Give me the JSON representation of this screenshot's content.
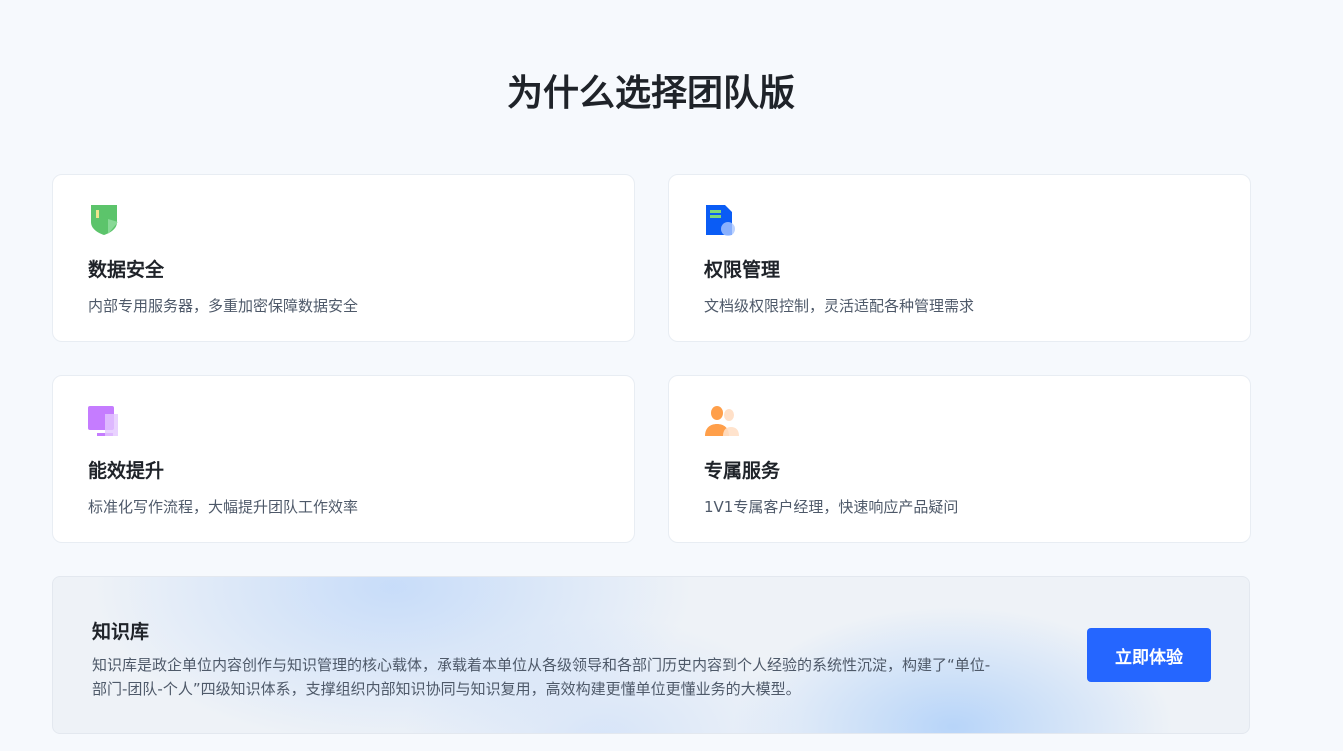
{
  "title": "为什么选择团队版",
  "features": [
    {
      "icon": "shield-icon",
      "title": "数据安全",
      "desc": "内部专用服务器，多重加密保障数据安全"
    },
    {
      "icon": "document-icon",
      "title": "权限管理",
      "desc": "文档级权限控制，灵活适配各种管理需求"
    },
    {
      "icon": "monitor-icon",
      "title": "能效提升",
      "desc": "标准化写作流程，大幅提升团队工作效率"
    },
    {
      "icon": "support-person-icon",
      "title": "专属服务",
      "desc": "1V1专属客户经理，快速响应产品疑问"
    }
  ],
  "knowledge": {
    "title": "知识库",
    "desc": "知识库是政企单位内容创作与知识管理的核心载体，承载着本单位从各级领导和各部门历史内容到个人经验的系统性沉淀，构建了“单位-部门-团队-个人”四级知识体系，支撑组织内部知识协同与知识复用，高效构建更懂单位更懂业务的大模型。",
    "button": "立即体验"
  },
  "colors": {
    "accent": "#2566ff"
  }
}
